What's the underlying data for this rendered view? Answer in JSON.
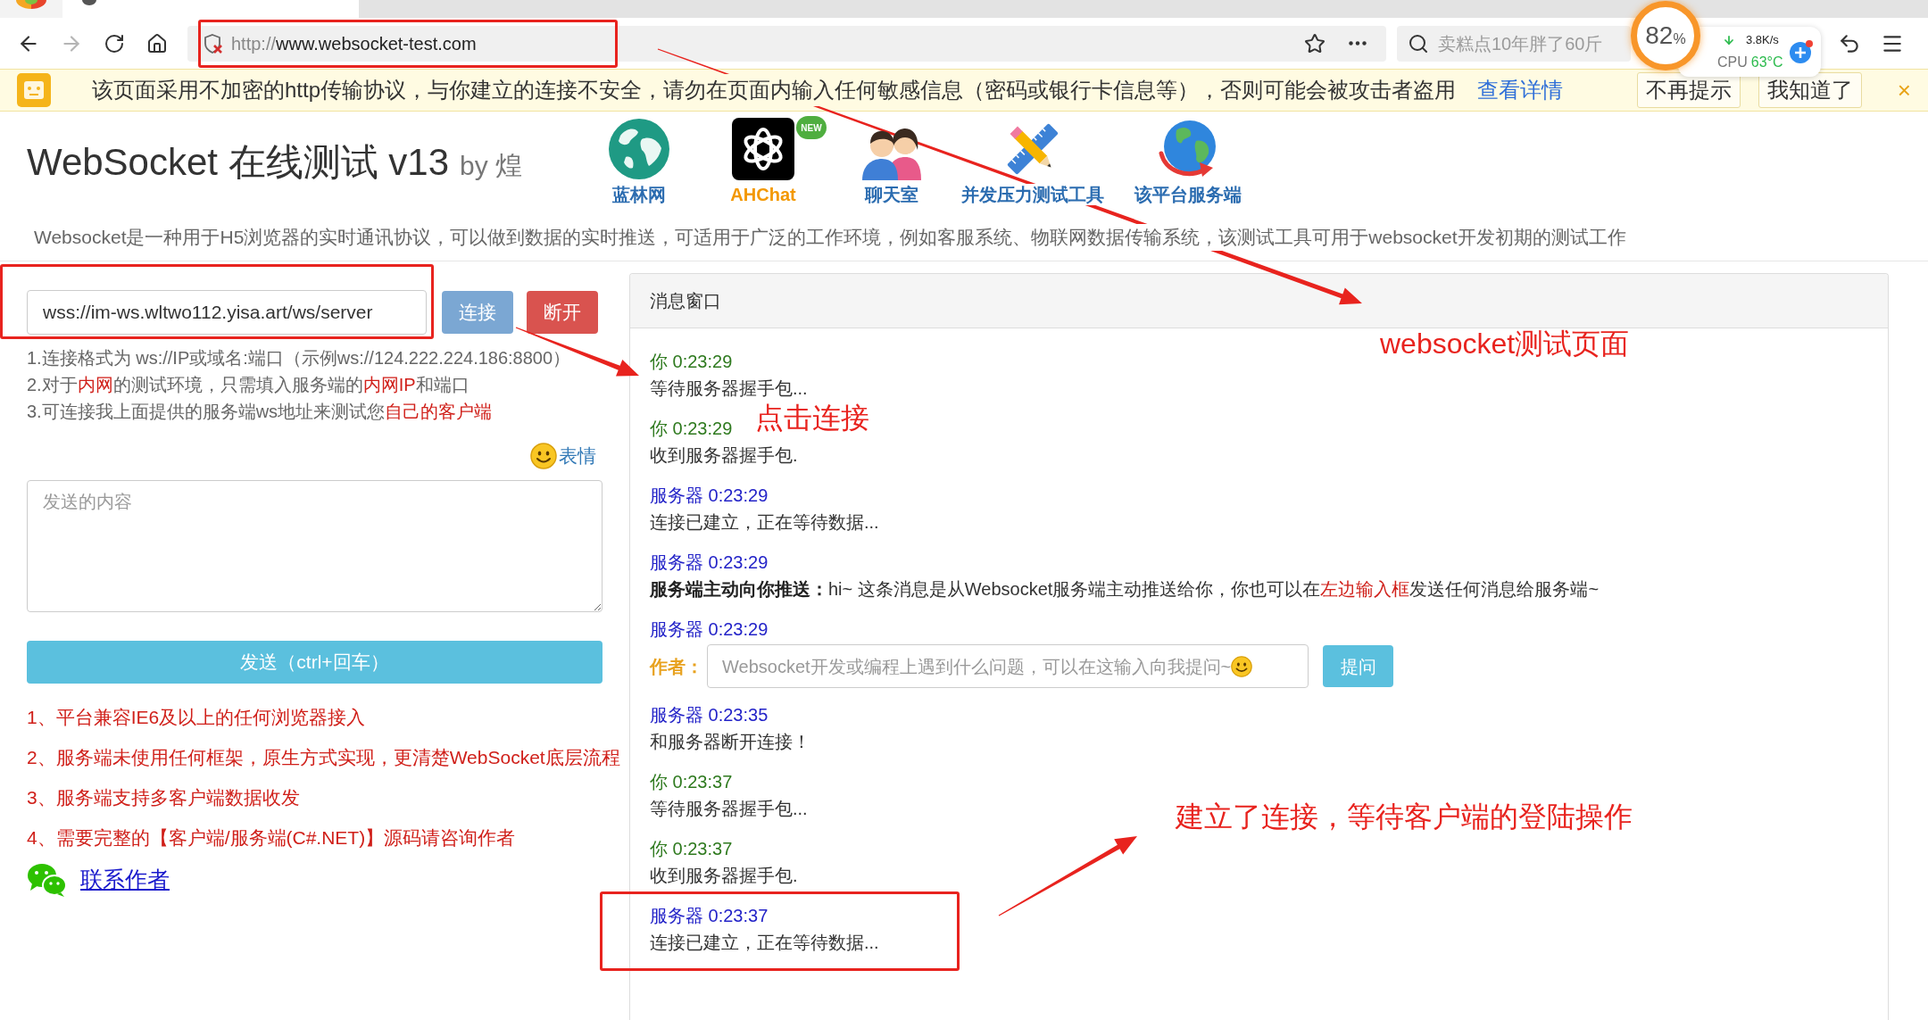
{
  "browser": {
    "forward_disabled": true,
    "url_scheme": "http://",
    "url_host": "www.websocket-test.com",
    "search_placeholder": "卖糕点10年胖了60斤"
  },
  "monitor": {
    "usage_value": "82",
    "usage_unit": "%",
    "speed": "3.8K/s",
    "cpu_label": "CPU",
    "cpu_temp": "63°C"
  },
  "security_bar": {
    "message": "该页面采用不加密的http传输协议，与你建立的连接不安全，请勿在页面内输入任何敏感信息（密码或银行卡信息等），否则可能会被攻击者盗用",
    "link": "查看详情",
    "buttons": [
      "不再提示",
      "我知道了"
    ],
    "close": "×"
  },
  "header": {
    "title": "WebSocket 在线测试 v13",
    "byline": "by 煌",
    "nav": [
      {
        "kind": "globe",
        "label": "蓝林网",
        "color": "#2b6cb0"
      },
      {
        "kind": "knot",
        "label": "AHChat",
        "color": "#f39800",
        "badge": "NEW"
      },
      {
        "kind": "people",
        "label": "聊天室",
        "color": "#2b6cb0"
      },
      {
        "kind": "tools",
        "label": "并发压力测试工具",
        "color": "#2b6cb0"
      },
      {
        "kind": "earth",
        "label": "该平台服务端",
        "color": "#2b6cb0"
      }
    ],
    "description": "Websocket是一种用于H5浏览器的实时通讯协议，可以做到数据的实时推送，可适用于广泛的工作环境，例如客服系统、物联网数据传输系统，该测试工具可用于websocket开发初期的测试工作"
  },
  "connection": {
    "url": "wss://im-ws.wltwo112.yisa.art/ws/server",
    "connect": "连接",
    "connect_disabled": true,
    "disconnect": "断开",
    "hints": [
      {
        "segments": [
          {
            "kind": "plain",
            "text": "1.连接格式为 ws://IP或域名:端口（示例ws://124.222.224.186:8800）"
          }
        ]
      },
      {
        "segments": [
          {
            "kind": "plain",
            "text": "2.对于"
          },
          {
            "kind": "red",
            "text": "内网"
          },
          {
            "kind": "plain",
            "text": "的测试环境，只需填入服务端的"
          },
          {
            "kind": "red",
            "text": "内网IP"
          },
          {
            "kind": "plain",
            "text": "和端口"
          }
        ]
      },
      {
        "segments": [
          {
            "kind": "plain",
            "text": "3.可连接我上面提供的服务端ws地址来测试您"
          },
          {
            "kind": "red",
            "text": "自己的客户端"
          }
        ]
      }
    ],
    "emoji_link": "表情",
    "input_placeholder": "发送的内容",
    "send": "发送（ctrl+回车）",
    "features": [
      "1、平台兼容IE6及以上的任何浏览器接入",
      "2、服务端未使用任何框架，原生方式实现，更清楚WebSocket底层流程",
      "3、服务端支持多客户端数据收发",
      "4、需要完整的【客户端/服务端(C#.NET)】源码请咨询作者"
    ],
    "contact": "联系作者"
  },
  "message_window": {
    "title": "消息窗口",
    "messages": [
      {
        "kind": "client",
        "header": "你 0:23:29",
        "body": [
          {
            "kind": "plain",
            "text": "等待服务器握手包..."
          }
        ]
      },
      {
        "kind": "client",
        "header": "你 0:23:29",
        "body": [
          {
            "kind": "plain",
            "text": "收到服务器握手包."
          }
        ]
      },
      {
        "kind": "server",
        "header": "服务器 0:23:29",
        "body": [
          {
            "kind": "plain",
            "text": "连接已建立，正在等待数据..."
          }
        ]
      },
      {
        "kind": "server",
        "header": "服务器 0:23:29",
        "body": [
          {
            "kind": "bold",
            "text": "服务端主动向你推送："
          },
          {
            "kind": "plain",
            "text": "hi~ 这条消息是从Websocket服务端主动推送给你，你也可以在"
          },
          {
            "kind": "red",
            "text": "左边输入框"
          },
          {
            "kind": "plain",
            "text": "发送任何消息给服务端~"
          }
        ]
      },
      {
        "kind": "server",
        "header": "服务器 0:23:29",
        "ask": {
          "label": "作者：",
          "placeholder": "Websocket开发或编程上遇到什么问题，可以在这输入向我提问~",
          "button": "提问"
        }
      },
      {
        "kind": "server",
        "header": "服务器 0:23:35",
        "body": [
          {
            "kind": "plain",
            "text": "和服务器断开连接！"
          }
        ]
      },
      {
        "kind": "client",
        "header": "你 0:23:37",
        "body": [
          {
            "kind": "plain",
            "text": "等待服务器握手包..."
          }
        ]
      },
      {
        "kind": "client",
        "header": "你 0:23:37",
        "body": [
          {
            "kind": "plain",
            "text": "收到服务器握手包."
          }
        ]
      },
      {
        "kind": "server",
        "header": "服务器 0:23:37",
        "body": [
          {
            "kind": "plain",
            "text": "连接已建立，正在等待数据..."
          }
        ]
      }
    ]
  },
  "annotations": [
    {
      "text": "websocket测试页面"
    },
    {
      "text": "点击连接"
    },
    {
      "text": "建立了连接，等待客户端的登陆操作"
    }
  ]
}
